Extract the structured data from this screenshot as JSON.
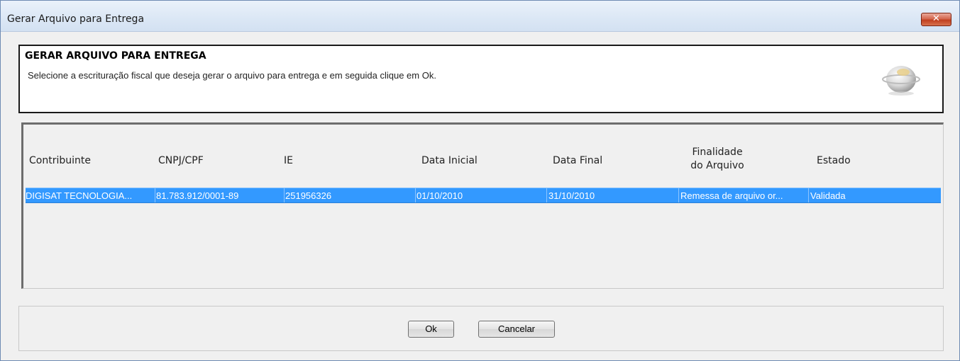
{
  "window": {
    "title": "Gerar Arquivo para Entrega",
    "close_glyph": "✕"
  },
  "header": {
    "title": "GERAR ARQUIVO PARA ENTREGA",
    "description": "Selecione a escrituração fiscal que deseja gerar o arquivo para entrega e em seguida clique em Ok.",
    "logo_icon": "sped-globe-icon"
  },
  "table": {
    "columns": [
      {
        "key": "contribuinte",
        "label_line1": "Contribuinte",
        "label_line2": ""
      },
      {
        "key": "cnpj",
        "label_line1": "CNPJ/CPF",
        "label_line2": ""
      },
      {
        "key": "ie",
        "label_line1": "IE",
        "label_line2": ""
      },
      {
        "key": "data_inicial",
        "label_line1": "Data Inicial",
        "label_line2": ""
      },
      {
        "key": "data_final",
        "label_line1": "Data Final",
        "label_line2": ""
      },
      {
        "key": "finalidade",
        "label_line1": "Finalidade",
        "label_line2": "do Arquivo"
      },
      {
        "key": "estado",
        "label_line1": "Estado",
        "label_line2": ""
      }
    ],
    "rows": [
      {
        "selected": true,
        "contribuinte": "DIGISAT TECNOLOGIA...",
        "cnpj": "81.783.912/0001-89",
        "ie": "251956326",
        "data_inicial": "01/10/2010",
        "data_final": "31/10/2010",
        "finalidade": "Remessa de arquivo or...",
        "estado": "Validada"
      }
    ]
  },
  "buttons": {
    "ok": "Ok",
    "cancel": "Cancelar"
  },
  "colors": {
    "selection": "#3399ff",
    "title_bar": "#dbe7f5",
    "close_button": "#c1401f"
  }
}
